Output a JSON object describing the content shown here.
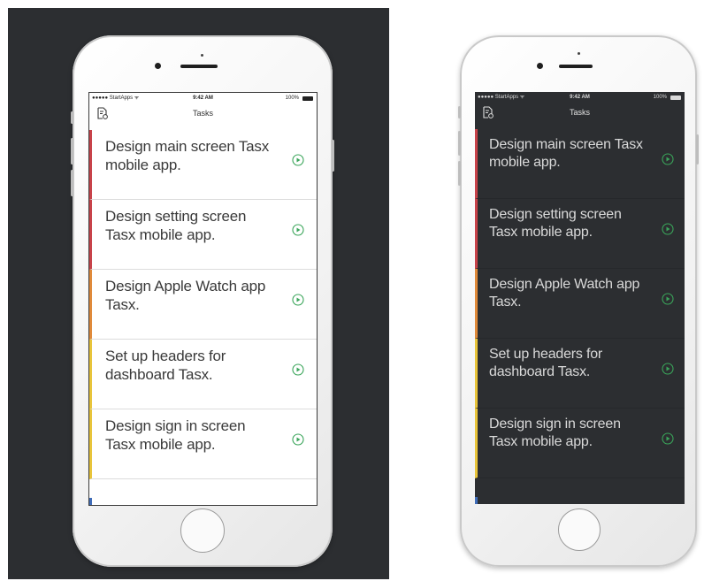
{
  "colors": {
    "backdrop": "#2c2e31",
    "light_screen_bg": "#ffffff",
    "dark_screen_bg": "#2c2e31",
    "light_text": "#3a3a3a",
    "dark_text": "#d9d9d9",
    "play_icon": "#3aa55a",
    "footer_accent": "#3f6cb8"
  },
  "status_bar": {
    "carrier": "●●●●● StartApps ᯤ",
    "time": "9:42 AM",
    "battery": "100%"
  },
  "nav": {
    "title": "Tasks",
    "icon": "document-edit-icon"
  },
  "tasks": [
    {
      "title": "Design main screen Tasx mobile app.",
      "accent": "#c8434a"
    },
    {
      "title": "Design setting screen Tasx mobile app.",
      "accent": "#c8434a"
    },
    {
      "title": "Design Apple Watch app Tasx.",
      "accent": "#e08a3a"
    },
    {
      "title": "Set up headers for dashboard Tasx.",
      "accent": "#e8c43a"
    },
    {
      "title": "Design sign in screen Tasx mobile app.",
      "accent": "#e8c43a"
    }
  ],
  "row_action_icon": "play-circle-icon"
}
